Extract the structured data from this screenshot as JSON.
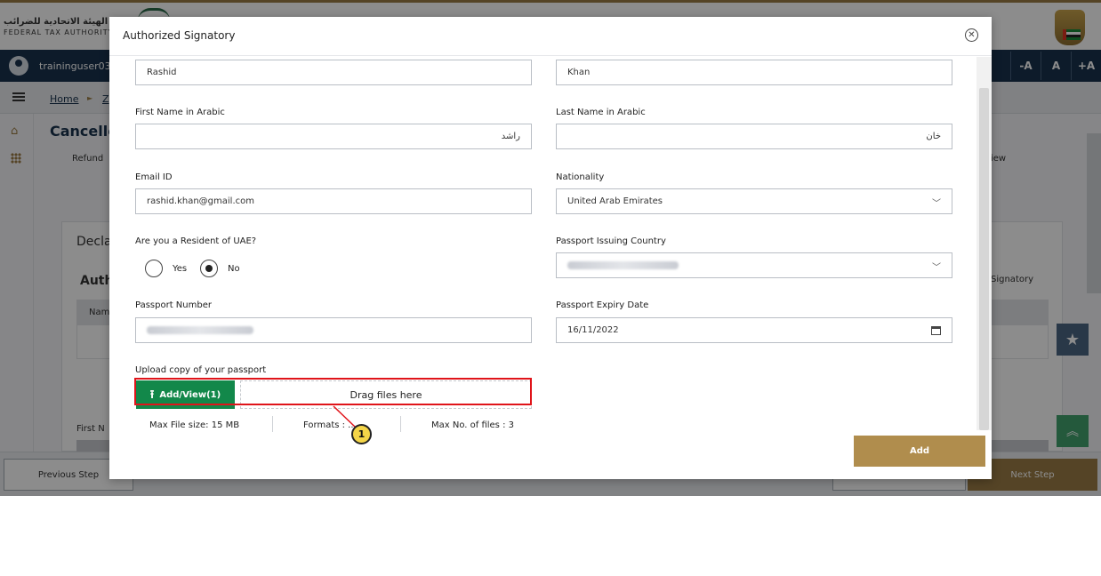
{
  "header": {
    "logo_arabic": "الهيئة الاتحادية للضرائب",
    "logo_english": "FEDERAL TAX AUTHORITY",
    "username": "traininguser03",
    "font_sizes": [
      "-A",
      "A",
      "+A"
    ]
  },
  "breadcrumb": {
    "home": "Home",
    "separator": "►",
    "next": "Z"
  },
  "page": {
    "title": "Cancelle",
    "refund_label": "Refund",
    "view_label": "iew",
    "declaration_title": "Decla",
    "auth_title": "Auth",
    "signatory_label": "Signatory",
    "table_col_name": "Nam",
    "first_name_label": "First N"
  },
  "footer": {
    "previous": "Previous Step",
    "next": "Next Step"
  },
  "modal": {
    "title": "Authorized Signatory",
    "close_icon": "close-icon",
    "first_name": "Rashid",
    "last_name": "Khan",
    "first_name_arabic_label": "First Name in Arabic",
    "first_name_arabic": "راشد",
    "last_name_arabic_label": "Last Name in Arabic",
    "last_name_arabic": "خان",
    "email_label": "Email ID",
    "email": "rashid.khan@gmail.com",
    "nationality_label": "Nationality",
    "nationality": "United Arab Emirates",
    "resident_label": "Are you a Resident of UAE?",
    "resident_yes": "Yes",
    "resident_no": "No",
    "resident_selected": "No",
    "passport_country_label": "Passport Issuing Country",
    "passport_number_label": "Passport Number",
    "passport_expiry_label": "Passport Expiry Date",
    "passport_expiry": "16/11/2022",
    "upload_label": "Upload copy of your passport",
    "upload_button": "Add/View(1)",
    "upload_icon": "upload-icon",
    "drag_text": "Drag files here",
    "max_file_size": "Max File size: 15 MB",
    "formats": "Formats : ...",
    "max_files": "Max No. of files : 3",
    "add_button": "Add"
  },
  "annotation": {
    "callout_number": "1",
    "highlight_color": "#e0141a"
  },
  "colors": {
    "brand_gold": "#9c7d45",
    "navy": "#18324d",
    "upload_green": "#12884a",
    "add_button": "#b08d4d"
  }
}
